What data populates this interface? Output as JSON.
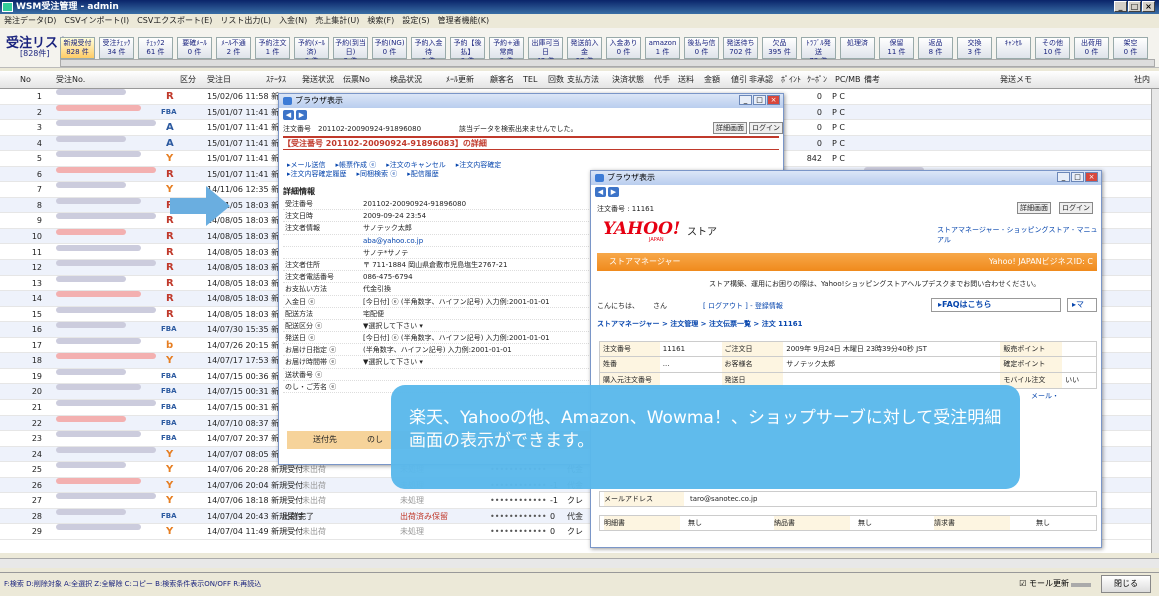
{
  "window": {
    "title": "WSM受注管理 - admin",
    "controls": [
      "_",
      "□",
      "×"
    ]
  },
  "menu": [
    "発注データ(D)",
    "CSVインポート(I)",
    "CSVエクスポート(E)",
    "リスト出力(L)",
    "入金(N)",
    "売上集計(U)",
    "検索(F)",
    "設定(S)",
    "管理者機能(K)"
  ],
  "list": {
    "title": "受注リスト",
    "count": "[828件]"
  },
  "status_buttons": [
    {
      "label": "新規受付",
      "count": "828 件",
      "active": true
    },
    {
      "label": "受注ﾁｪｯｸ",
      "count": "34 件"
    },
    {
      "label": "ﾁｪｯｸ2",
      "count": "61 件"
    },
    {
      "label": "要確ﾒｰﾙ",
      "count": "0 件"
    },
    {
      "label": "ﾒｰﾙ不通",
      "count": "2 件"
    },
    {
      "label": "予約注文",
      "count": "1 件"
    },
    {
      "label": "予約(ﾒｰﾙ済)",
      "count": "0 件"
    },
    {
      "label": "予約(到当日)",
      "count": "2 件"
    },
    {
      "label": "予約(NG)",
      "count": "0 件"
    },
    {
      "label": "予約入金待",
      "count": "0 件"
    },
    {
      "label": "予約【後払】",
      "count": "0 件"
    },
    {
      "label": "予約+通常商",
      "count": "0 件"
    },
    {
      "label": "出庫可当日",
      "count": "42 件"
    },
    {
      "label": "発送前入金",
      "count": "67 件"
    },
    {
      "label": "入金あり",
      "count": "0 件"
    },
    {
      "label": "amazon",
      "count": "1 件"
    },
    {
      "label": "後払与信",
      "count": "0 件"
    },
    {
      "label": "発送待ち",
      "count": "702 件"
    },
    {
      "label": "欠品",
      "count": "395 件"
    },
    {
      "label": "ﾄﾗﾌﾞﾙ発送",
      "count": "72 件"
    },
    {
      "label": "処理済",
      "count": ""
    },
    {
      "label": "保留",
      "count": "11 件"
    },
    {
      "label": "返品",
      "count": "8 件"
    },
    {
      "label": "交換",
      "count": "3 件"
    },
    {
      "label": "ｷｬﾝｾﾙ",
      "count": ""
    },
    {
      "label": "その他",
      "count": "10 件"
    },
    {
      "label": "出荷用",
      "count": "0 件"
    },
    {
      "label": "架空",
      "count": "0 件"
    }
  ],
  "columns": [
    "No",
    "受注No.",
    "区分",
    "受注日",
    "ｽﾃｰﾀｽ",
    "発送状況",
    "伝票No",
    "検品状況",
    "ﾒｰﾙ更新",
    "顧客名",
    "TEL",
    "回数",
    "支払方法",
    "決済状態",
    "代手",
    "送料",
    "金額",
    "値引",
    "非承認",
    "ﾎﾟｲﾝﾄ",
    "ｸｰﾎﾟﾝ",
    "PC/MB",
    "備考",
    "発送メモ",
    "社内"
  ],
  "rows": [
    {
      "no": "1",
      "mall": "R",
      "date": "15/02/06 11:58 新"
    },
    {
      "no": "2",
      "mall": "FBA",
      "date": "15/01/07 11:41 新"
    },
    {
      "no": "3",
      "mall": "A",
      "date": "15/01/07 11:41 新"
    },
    {
      "no": "4",
      "mall": "A",
      "date": "15/01/07 11:41 新"
    },
    {
      "no": "5",
      "mall": "Y",
      "date": "15/01/07 11:41 新"
    },
    {
      "no": "6",
      "mall": "R",
      "date": "15/01/07 11:41 新"
    },
    {
      "no": "7",
      "mall": "Y",
      "date": "14/11/06 12:35 新"
    },
    {
      "no": "8",
      "mall": "R",
      "date": "14/11/05 18:03 新"
    },
    {
      "no": "9",
      "mall": "R",
      "date": "14/08/05 18:03 新"
    },
    {
      "no": "10",
      "mall": "R",
      "date": "14/08/05 18:03 新"
    },
    {
      "no": "11",
      "mall": "R",
      "date": "14/08/05 18:03 新"
    },
    {
      "no": "12",
      "mall": "R",
      "date": "14/08/05 18:03 新"
    },
    {
      "no": "13",
      "mall": "R",
      "date": "14/08/05 18:03 新"
    },
    {
      "no": "14",
      "mall": "R",
      "date": "14/08/05 18:03 新"
    },
    {
      "no": "15",
      "mall": "R",
      "date": "14/08/05 18:03 新"
    },
    {
      "no": "16",
      "mall": "FBA",
      "date": "14/07/30 15:35 新"
    },
    {
      "no": "17",
      "mall": "b",
      "date": "14/07/26 20:15 新"
    },
    {
      "no": "18",
      "mall": "Y",
      "date": "14/07/17 17:53 新"
    },
    {
      "no": "19",
      "mall": "FBA",
      "date": "14/07/15 00:36 新"
    },
    {
      "no": "20",
      "mall": "FBA",
      "date": "14/07/15 00:31 新"
    },
    {
      "no": "21",
      "mall": "FBA",
      "date": "14/07/15 00:31 新"
    },
    {
      "no": "22",
      "mall": "FBA",
      "date": "14/07/10 08:37 新"
    },
    {
      "no": "23",
      "mall": "FBA",
      "date": "14/07/07 20:37 新"
    },
    {
      "no": "24",
      "mall": "Y",
      "date": "14/07/07 08:05 新規受付",
      "ship": "出荷可"
    },
    {
      "no": "25",
      "mall": "Y",
      "date": "14/07/06 20:28 新規受付",
      "ship": "未出荷",
      "check": "未処理",
      "pay": "代金"
    },
    {
      "no": "26",
      "mall": "Y",
      "date": "14/07/06 20:04 新規受付",
      "ship": "未出荷",
      "check": "未処理",
      "times": "-1",
      "pay": "代金"
    },
    {
      "no": "27",
      "mall": "Y",
      "date": "14/07/06 18:18 新規受付",
      "ship": "未出荷",
      "check": "未処理",
      "times": "-1",
      "pay": "クレ"
    },
    {
      "no": "28",
      "mall": "FBA",
      "date": "14/07/04 20:43 新規受付",
      "status": "出荷完了",
      "check": "出荷済み保留",
      "times": "0",
      "pay": "代金"
    },
    {
      "no": "29",
      "mall": "Y",
      "date": "14/07/04 11:49 新規受付",
      "ship": "未出荷",
      "check": "未処理",
      "times": "0",
      "pay": "クレ"
    }
  ],
  "right_values": [
    {
      "point": "0",
      "pc": "P C"
    },
    {
      "point": "0",
      "pc": "P C"
    },
    {
      "point": "0",
      "pc": "P C"
    },
    {
      "point": "0",
      "pc": "P C"
    },
    {
      "point": "842",
      "pc": "P C"
    },
    {
      "point": "0",
      "pc": "P C"
    }
  ],
  "popup1": {
    "title": "ブラウザ表示",
    "order_label": "注文番号",
    "order_value": "201102-20090924-91896080",
    "notice": "該当データを検索出来ませんでした。",
    "btn_detail": "詳細画面",
    "btn_login": "ログイン",
    "header": "【受注番号 201102-20090924-91896083】の詳細",
    "links1": [
      "▸メール送信",
      "▸帳票作成 ⓔ",
      "▸注文のキャンセル",
      "▸注文内容確定"
    ],
    "links2": [
      "▸注文内容確定履歴",
      "▸同梱検索 ⓔ",
      "▸配信履歴"
    ],
    "section": "詳細情報",
    "fields": [
      {
        "label": "受注番号",
        "value": "201102-20090924-91896080"
      },
      {
        "label": "注文日時",
        "value": "2009-09-24 23:54"
      },
      {
        "label": "注文者情報",
        "value": "サノテック太郎"
      },
      {
        "label": "",
        "value": "aba@yahoo.co.jp"
      },
      {
        "label": "",
        "value": "サノテ*サノテ"
      },
      {
        "label": "注文者住所",
        "value": "〒 711-1884 岡山県倉敷市児島塩生2767-21"
      },
      {
        "label": "注文者電話番号",
        "value": "086-475-6794"
      },
      {
        "label": "お支払い方法",
        "value": "代金引換"
      },
      {
        "label": "入金日 ⓔ",
        "value": "[今日付] ⓔ (半角数字、ハイフン記号) 入力例:2001-01-01"
      },
      {
        "label": "配送方法",
        "value": "宅配便"
      },
      {
        "label": "配送区分 ⓔ",
        "value": "▼選択して下さい ▾"
      },
      {
        "label": "発送日 ⓔ",
        "value": "[今日付] ⓔ (半角数字、ハイフン記号) 入力例:2001-01-01"
      },
      {
        "label": "お届け日指定 ⓔ",
        "value": "(半角数字、ハイフン記号) 入力例:2001-01-01"
      },
      {
        "label": "お届け時間帯 ⓔ",
        "value": "▼選択して下さい ▾"
      },
      {
        "label": "送状番号 ⓔ",
        "value": ""
      },
      {
        "label": "のし・ご芳名 ⓔ",
        "value": ""
      }
    ],
    "bottom_tab1": "送付先",
    "bottom_tab2": "のし"
  },
  "popup2": {
    "title": "ブラウザ表示",
    "order_label": "注文番号 : 11161",
    "btn_detail": "詳細画面",
    "btn_login": "ログイン",
    "brand": "YAHOO!",
    "brand_sub": "JAPAN",
    "store": "ストア",
    "toplinks": "ストアマネージャー - ショッピングストア - マニュアル",
    "manager": "ストアマネージャー",
    "manager_right": "Yahoo! JAPANビジネスID: C",
    "help": "ストア構築、運用にお困りの際は、Yahoo!ショッピングストアヘルプデスクまでお問い合わせください。",
    "hello": "こんにちは、",
    "san": "さん",
    "logout": "[ ログアウト ] - 登録情報",
    "faq": "▸FAQはこちら",
    "breadcrumb": "ストアマネージャー > 注文管理 > 注文伝票一覧 > 注文 11161",
    "table": [
      [
        "注文番号",
        "11161",
        "ご注文日",
        "2009年 9月24日 木曜日 23時39分40秒 JST",
        "販売ポイント",
        ""
      ],
      [
        "姓番",
        "...",
        "お客様名",
        "サノテック太郎",
        "確定ポイント",
        ""
      ],
      [
        "購入元注文番号",
        "",
        "発送日",
        "",
        "モバイル注文",
        "いい"
      ]
    ],
    "mail_label": "メールアドレス",
    "mail_value": "taro@sanotec.co.jp",
    "bottom_row": [
      "明細書",
      "無し",
      "納品書",
      "無し",
      "請求書",
      "無し"
    ],
    "mail_link": "メール・"
  },
  "callout": "楽天、Yahooの他、Amazon、Wowma！、ショップサーブに対して受注明細画面の表示ができます。",
  "statusbar": "F:検索 D:削除対象 A:全選択 Z:全解除 C:コピー B:検索条件表示ON/OFF R:再読込",
  "mode_label": "☑ モール更新",
  "close_label": "閉じる",
  "colors": {
    "accent": "#5bb9ec",
    "rakuten": "#c0392b",
    "yahoo": "#e60012"
  }
}
